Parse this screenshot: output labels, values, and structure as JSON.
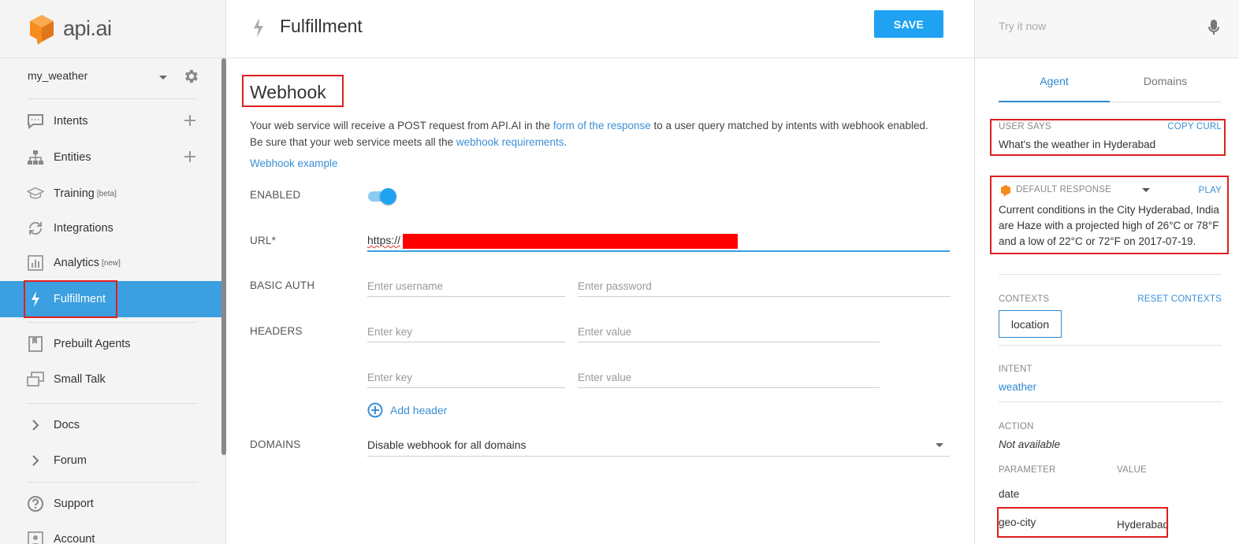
{
  "brand": {
    "name": "api.ai",
    "logo_color": "#f68c1e"
  },
  "agent": {
    "name": "my_weather"
  },
  "sidebar": {
    "items": [
      {
        "label": "Intents",
        "sup": ""
      },
      {
        "label": "Entities",
        "sup": ""
      },
      {
        "label": "Training",
        "sup": "[beta]"
      },
      {
        "label": "Integrations",
        "sup": ""
      },
      {
        "label": "Analytics",
        "sup": "[new]"
      },
      {
        "label": "Fulfillment",
        "sup": ""
      },
      {
        "label": "Prebuilt Agents",
        "sup": ""
      },
      {
        "label": "Small Talk",
        "sup": ""
      },
      {
        "label": "Docs",
        "sup": ""
      },
      {
        "label": "Forum",
        "sup": ""
      },
      {
        "label": "Support",
        "sup": ""
      },
      {
        "label": "Account",
        "sup": ""
      }
    ]
  },
  "header": {
    "title": "Fulfillment",
    "save_label": "SAVE"
  },
  "webhook": {
    "title": "Webhook",
    "desc_1": "Your web service will receive a POST request from API.AI in the ",
    "desc_link_1": "form of the response",
    "desc_2": " to a user query matched by intents with webhook enabled.",
    "desc_3": "Be sure that your web service meets all the ",
    "desc_link_2": "webhook requirements",
    "desc_4": ".",
    "example_link": "Webhook example",
    "enabled_label": "ENABLED",
    "enabled": true,
    "url_label": "URL*",
    "url_value": "https://",
    "basic_auth_label": "BASIC AUTH",
    "username_placeholder": "Enter username",
    "password_placeholder": "Enter password",
    "headers_label": "HEADERS",
    "key_placeholder": "Enter key",
    "value_placeholder": "Enter value",
    "add_header": "Add header",
    "domains_label": "DOMAINS",
    "domains_value": "Disable webhook for all domains"
  },
  "panel": {
    "try_placeholder": "Try it now",
    "tab_agent": "Agent",
    "tab_domains": "Domains",
    "user_says_label": "USER SAYS",
    "copy_curl": "COPY CURL",
    "user_says": "What's the weather in Hyderabad",
    "default_response_label": "DEFAULT RESPONSE",
    "play": "PLAY",
    "response": "Current conditions in the City Hyderabad, India are Haze with a projected high of 26°C or 78°F and a low of 22°C or 72°F on 2017-07-19.",
    "contexts_label": "CONTEXTS",
    "reset_contexts": "RESET CONTEXTS",
    "context_chip": "location",
    "intent_label": "INTENT",
    "intent": "weather",
    "action_label": "ACTION",
    "action": "Not available",
    "parameter_label": "PARAMETER",
    "value_label": "VALUE",
    "params": [
      {
        "name": "date",
        "value": ""
      },
      {
        "name": "geo-city",
        "value": "Hyderabad"
      }
    ]
  },
  "colors": {
    "accent": "#1fa2f2",
    "active_nav": "#3b9fe0",
    "highlight": "#e01e1e"
  }
}
